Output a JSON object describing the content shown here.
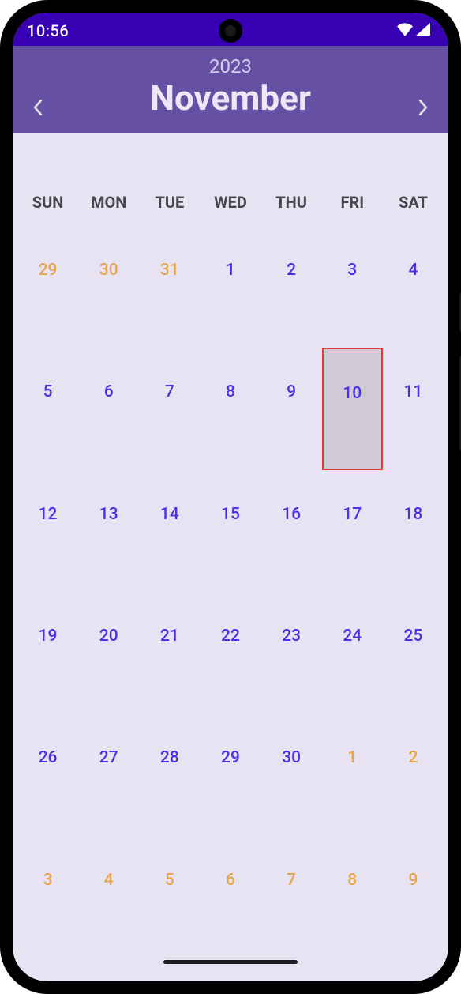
{
  "status": {
    "time": "10:56"
  },
  "header": {
    "year": "2023",
    "month": "November"
  },
  "dow": [
    "SUN",
    "MON",
    "TUE",
    "WED",
    "THU",
    "FRI",
    "SAT"
  ],
  "days": [
    {
      "n": "29",
      "in": false
    },
    {
      "n": "30",
      "in": false
    },
    {
      "n": "31",
      "in": false
    },
    {
      "n": "1",
      "in": true
    },
    {
      "n": "2",
      "in": true
    },
    {
      "n": "3",
      "in": true
    },
    {
      "n": "4",
      "in": true
    },
    {
      "n": "5",
      "in": true
    },
    {
      "n": "6",
      "in": true
    },
    {
      "n": "7",
      "in": true
    },
    {
      "n": "8",
      "in": true
    },
    {
      "n": "9",
      "in": true
    },
    {
      "n": "10",
      "in": true,
      "selected": true
    },
    {
      "n": "11",
      "in": true
    },
    {
      "n": "12",
      "in": true
    },
    {
      "n": "13",
      "in": true
    },
    {
      "n": "14",
      "in": true
    },
    {
      "n": "15",
      "in": true
    },
    {
      "n": "16",
      "in": true
    },
    {
      "n": "17",
      "in": true
    },
    {
      "n": "18",
      "in": true
    },
    {
      "n": "19",
      "in": true
    },
    {
      "n": "20",
      "in": true
    },
    {
      "n": "21",
      "in": true
    },
    {
      "n": "22",
      "in": true
    },
    {
      "n": "23",
      "in": true
    },
    {
      "n": "24",
      "in": true
    },
    {
      "n": "25",
      "in": true
    },
    {
      "n": "26",
      "in": true
    },
    {
      "n": "27",
      "in": true
    },
    {
      "n": "28",
      "in": true
    },
    {
      "n": "29",
      "in": true
    },
    {
      "n": "30",
      "in": true
    },
    {
      "n": "1",
      "in": false
    },
    {
      "n": "2",
      "in": false
    },
    {
      "n": "3",
      "in": false
    },
    {
      "n": "4",
      "in": false
    },
    {
      "n": "5",
      "in": false
    },
    {
      "n": "6",
      "in": false
    },
    {
      "n": "7",
      "in": false
    },
    {
      "n": "8",
      "in": false
    },
    {
      "n": "9",
      "in": false
    }
  ]
}
